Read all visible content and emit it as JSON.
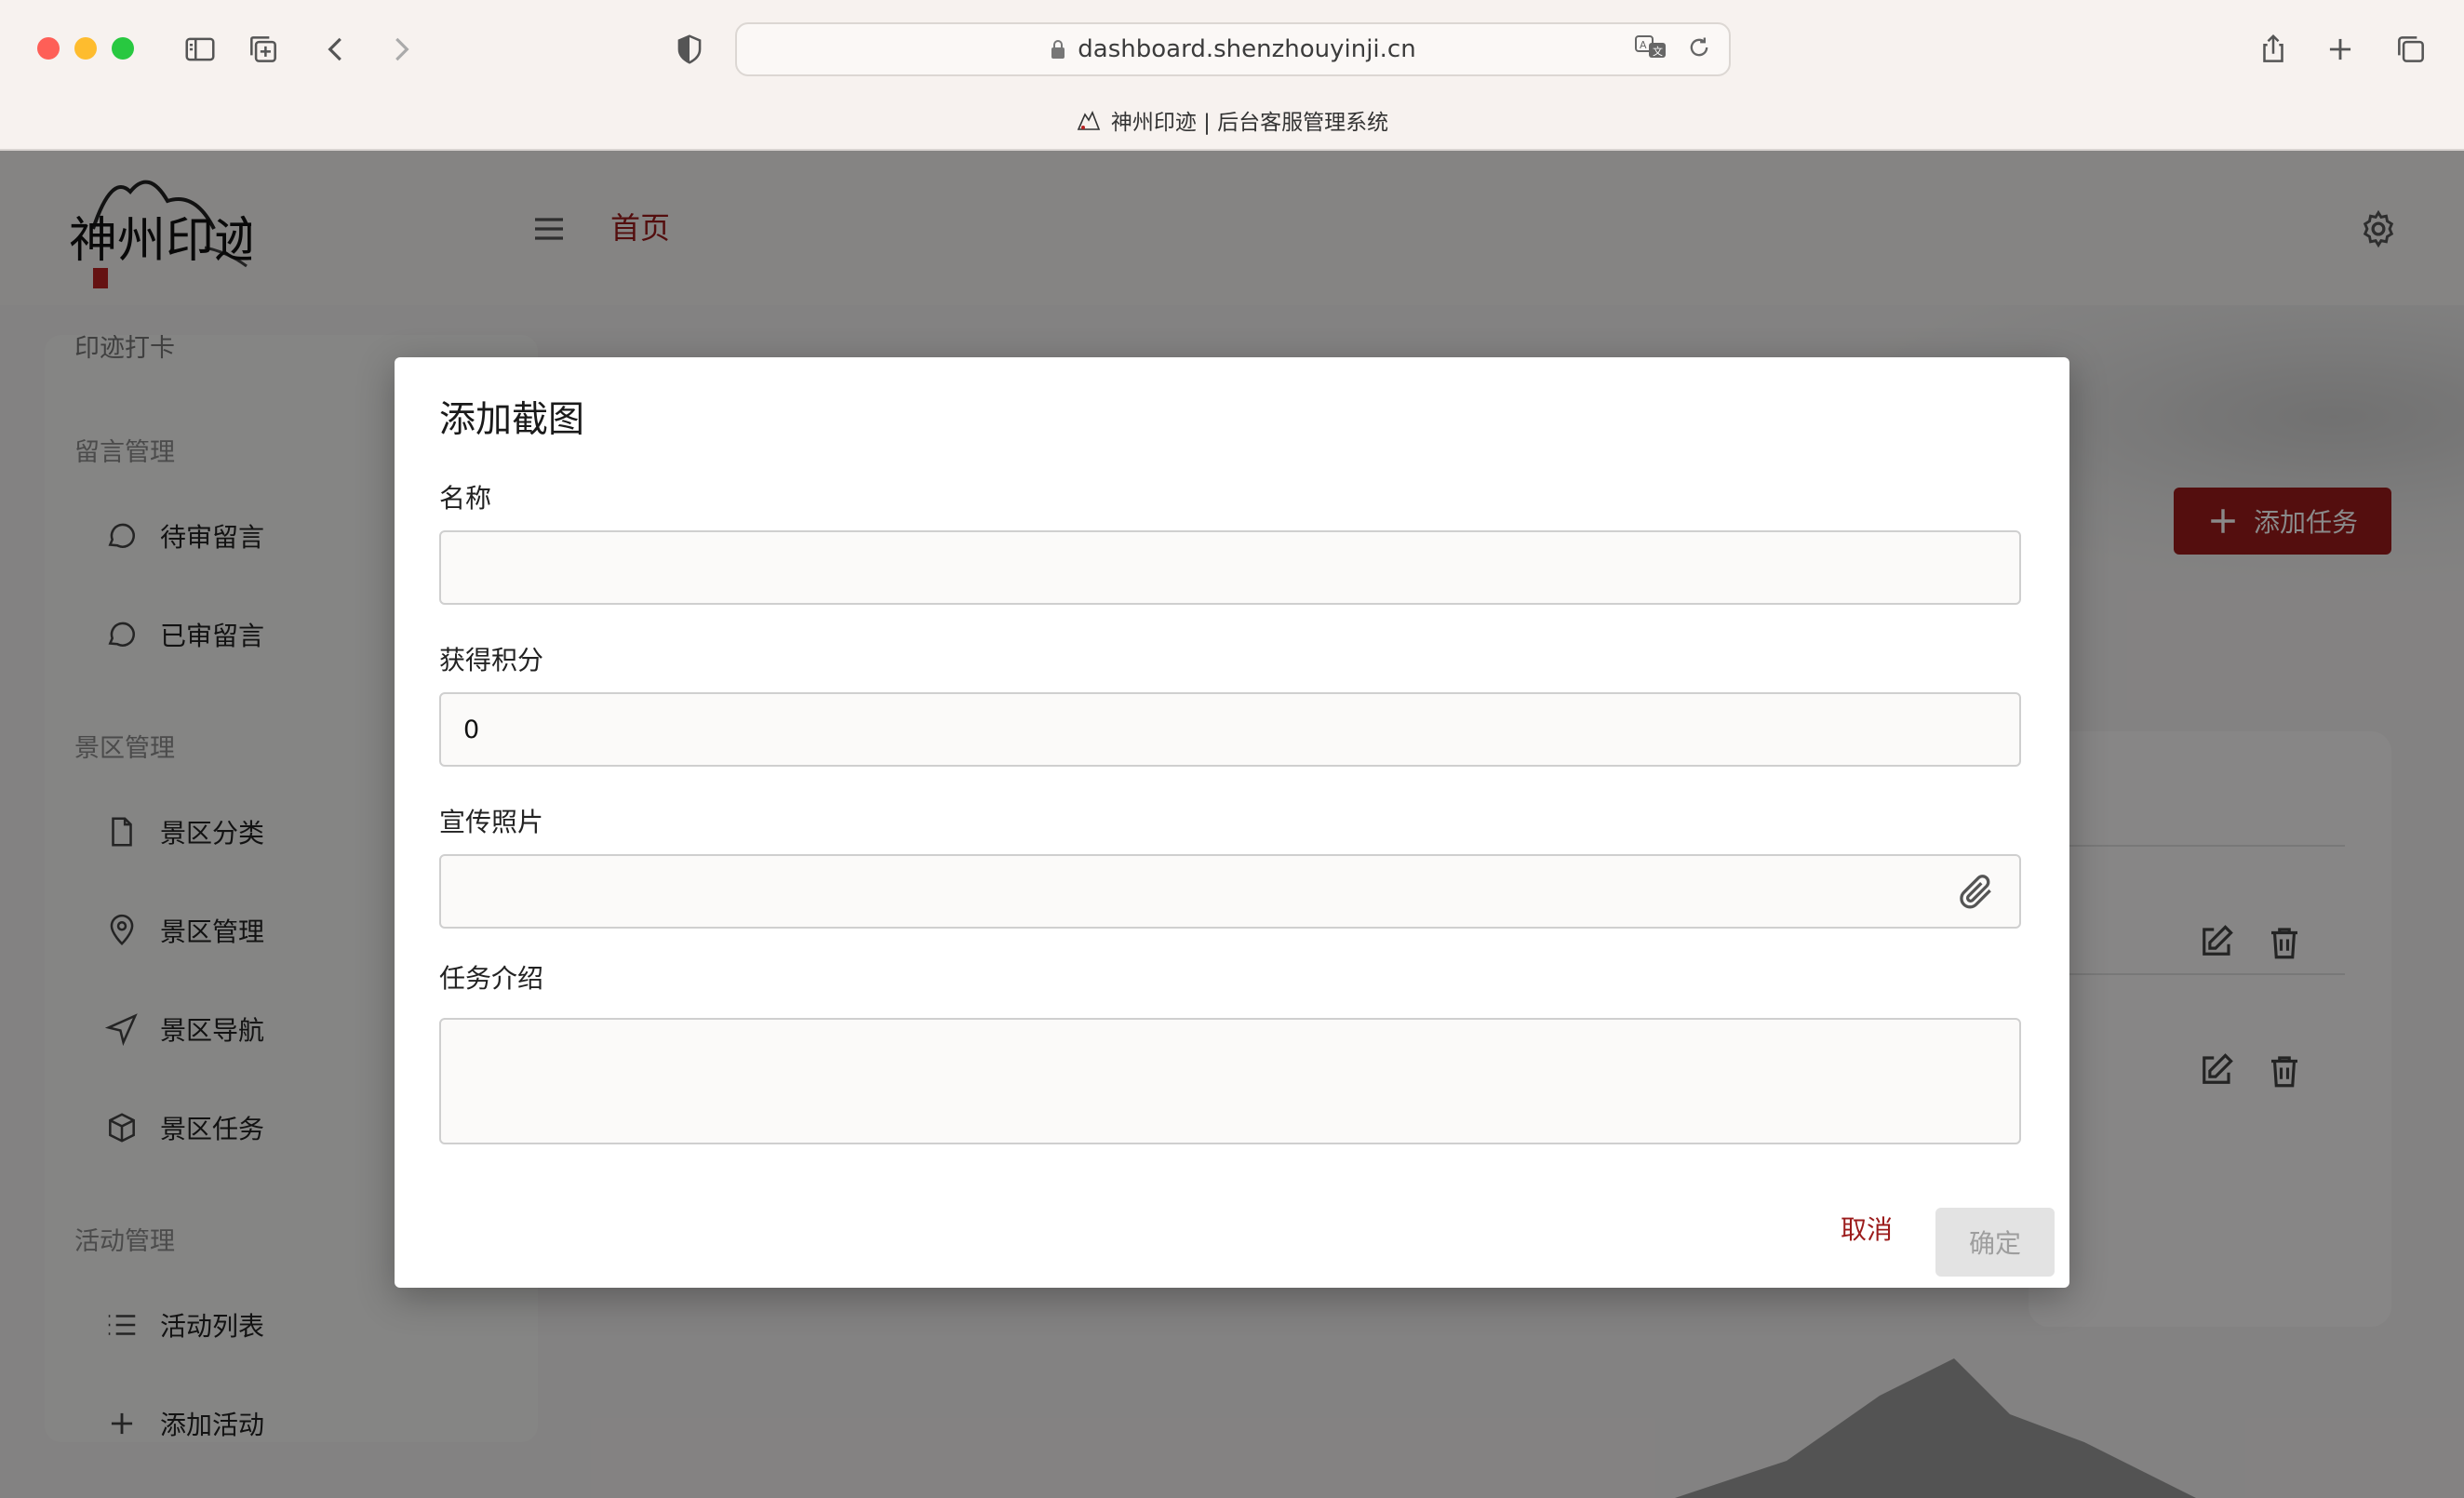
{
  "browser": {
    "url": "dashboard.shenzhouyinji.cn",
    "tab_title": "神州印迹 | 后台客服管理系统"
  },
  "header": {
    "breadcrumb": "首页",
    "logo_text": "神州印迹"
  },
  "sidebar": {
    "partial_top_item": "印迹打卡",
    "sections": [
      {
        "title": "留言管理",
        "items": [
          {
            "label": "待审留言",
            "icon": "chat-icon"
          },
          {
            "label": "已审留言",
            "icon": "chat-icon"
          }
        ]
      },
      {
        "title": "景区管理",
        "items": [
          {
            "label": "景区分类",
            "icon": "file-icon"
          },
          {
            "label": "景区管理",
            "icon": "map-pin-icon"
          },
          {
            "label": "景区导航",
            "icon": "navigation-icon"
          },
          {
            "label": "景区任务",
            "icon": "box-icon"
          }
        ]
      },
      {
        "title": "活动管理",
        "items": [
          {
            "label": "活动列表",
            "icon": "list-icon"
          },
          {
            "label": "添加活动",
            "icon": "plus-icon"
          }
        ]
      }
    ]
  },
  "main": {
    "add_task_label": "添加任务"
  },
  "dialog": {
    "title": "添加截图",
    "fields": {
      "name_label": "名称",
      "name_value": "",
      "points_label": "获得积分",
      "points_value": "0",
      "photo_label": "宣传照片",
      "photo_value": "",
      "intro_label": "任务介绍",
      "intro_value": ""
    },
    "cancel_label": "取消",
    "confirm_label": "确定"
  },
  "colors": {
    "brand_red": "#9b1b1b",
    "overlay": "rgba(0,0,0,0.46)"
  }
}
